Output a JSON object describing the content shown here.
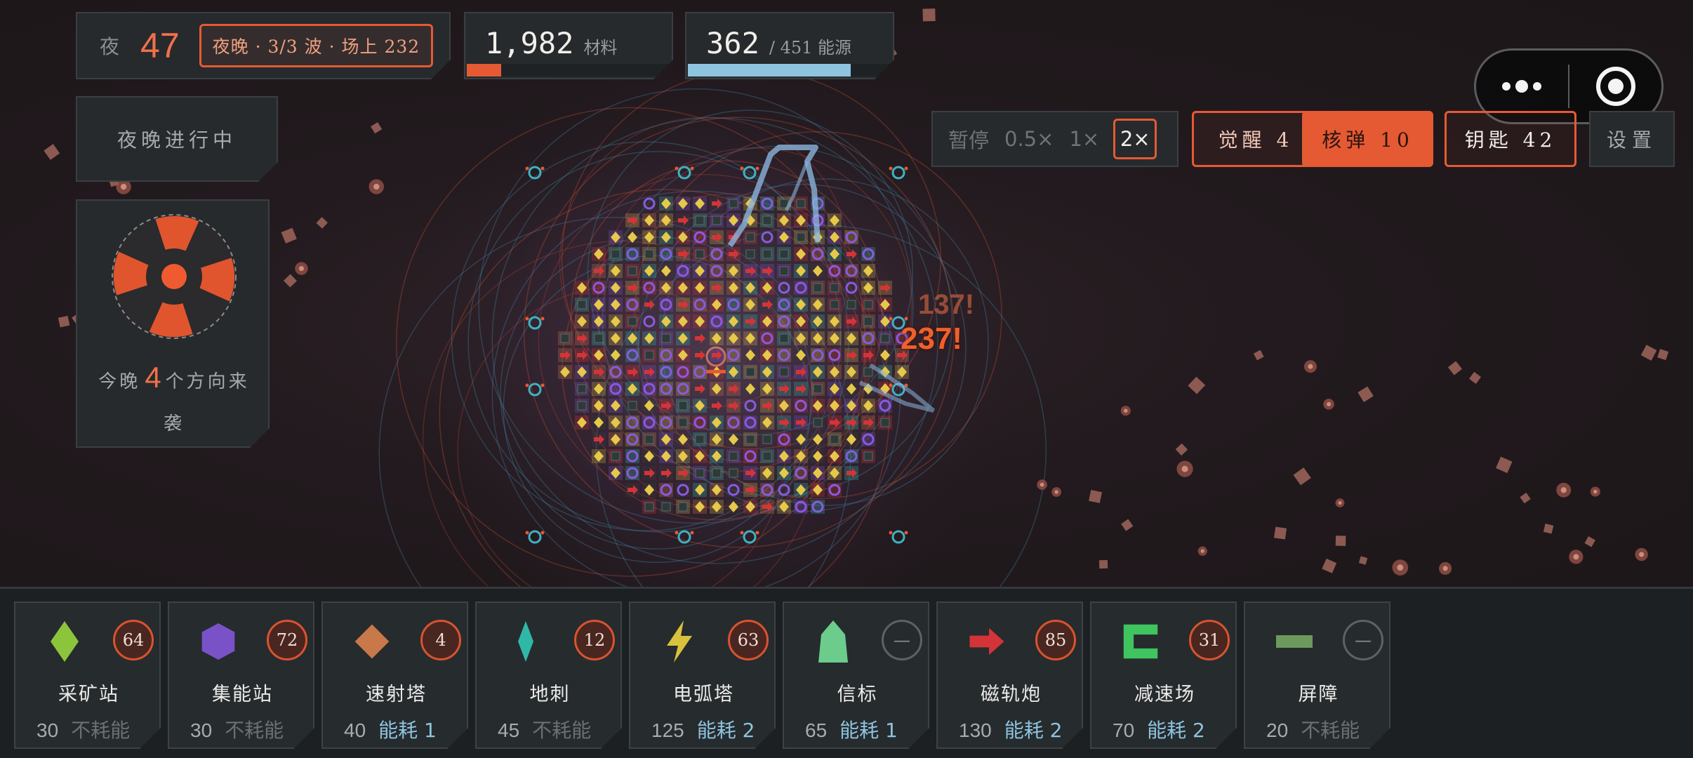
{
  "hud": {
    "night_label": "夜",
    "night_number": "47",
    "wave_badge": "夜晚 · 3/3 波 · 场上 232",
    "materials_value": "1,982",
    "materials_label": "材料",
    "materials_fill_pct": 17,
    "energy_value": "362",
    "energy_label": "/ 451 能源",
    "energy_fill_pct": 80,
    "status": "夜晚进行中",
    "direction_prefix": "今晚",
    "direction_count": "4",
    "direction_suffix": "个方向来袭"
  },
  "speed": {
    "pause": "暂停",
    "half": "0.5×",
    "one": "1×",
    "two": "2×",
    "selected": "2×"
  },
  "actions": {
    "awaken": "觉醒 4",
    "nuke": "核弹 10",
    "keys": "钥匙 42",
    "settings": "设置"
  },
  "damage_numbers": [
    "137!",
    "237!"
  ],
  "buildings": [
    {
      "name": "采矿站",
      "count": "64",
      "cost": "30",
      "energy": "不耗能",
      "icon": "green-diamond-icon",
      "color": "#8cc43c"
    },
    {
      "name": "集能站",
      "count": "72",
      "cost": "30",
      "energy": "不耗能",
      "icon": "purple-hexagon-icon",
      "color": "#7a52c8"
    },
    {
      "name": "速射塔",
      "count": "4",
      "cost": "40",
      "energy": "能耗 1",
      "icon": "orange-diamond-icon",
      "color": "#c9784a"
    },
    {
      "name": "地刺",
      "count": "12",
      "cost": "45",
      "energy": "不耗能",
      "icon": "teal-spike-icon",
      "color": "#2fb8a8"
    },
    {
      "name": "电弧塔",
      "count": "63",
      "cost": "125",
      "energy": "能耗 2",
      "icon": "lightning-icon",
      "color": "#d8c23c"
    },
    {
      "name": "信标",
      "count": "—",
      "cost": "65",
      "energy": "能耗 1",
      "icon": "beacon-icon",
      "color": "#6ccc8c"
    },
    {
      "name": "磁轨炮",
      "count": "85",
      "cost": "130",
      "energy": "能耗 2",
      "icon": "red-arrow-icon",
      "color": "#d43438"
    },
    {
      "name": "减速场",
      "count": "31",
      "cost": "70",
      "energy": "能耗 2",
      "icon": "green-bracket-icon",
      "color": "#3fc460"
    },
    {
      "name": "屏障",
      "count": "—",
      "cost": "20",
      "energy": "不耗能",
      "icon": "barrier-bar-icon",
      "color": "#6c9a5c"
    }
  ]
}
